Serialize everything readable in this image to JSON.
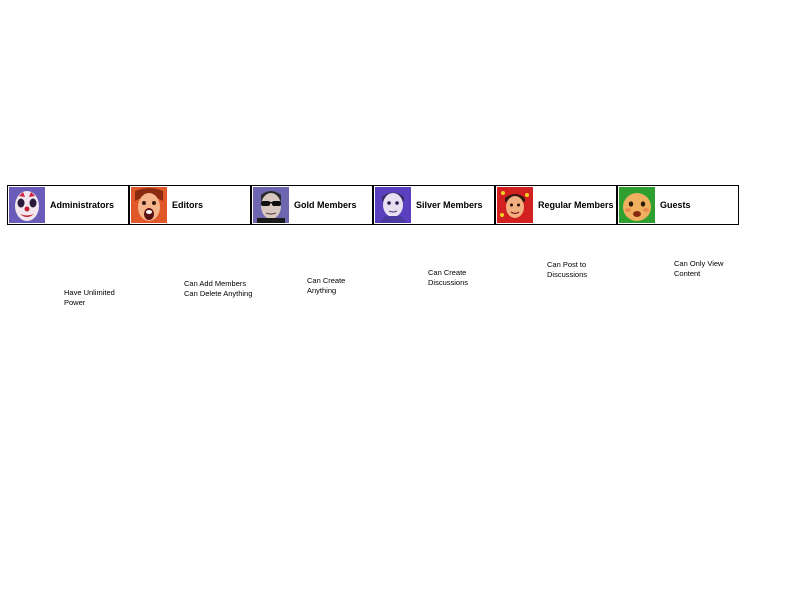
{
  "roles": [
    {
      "label": "Administrators",
      "avatar_icon": "clown-face-icon",
      "avatar_bg": "#6b5bb8",
      "permissions": [
        "Have Unlimited",
        "Power"
      ]
    },
    {
      "label": "Editors",
      "avatar_icon": "screaming-face-icon",
      "avatar_bg": "#e0582a",
      "permissions": [
        "Can Add Members",
        "Can Delete Anything"
      ]
    },
    {
      "label": "Gold Members",
      "avatar_icon": "sunglasses-face-icon",
      "avatar_bg": "#6e66b0",
      "permissions": [
        "Can Create",
        "Anything"
      ]
    },
    {
      "label": "Silver Members",
      "avatar_icon": "boy-face-icon",
      "avatar_bg": "#5a3fbf",
      "permissions": [
        "Can Create",
        "Discussions"
      ]
    },
    {
      "label": "Regular Members",
      "avatar_icon": "kid-face-icon",
      "avatar_bg": "#d22020",
      "permissions": [
        "Can Post to",
        "Discussions"
      ]
    },
    {
      "label": "Guests",
      "avatar_icon": "baby-face-icon",
      "avatar_bg": "#2fa02f",
      "permissions": [
        "Can Only View",
        "Content"
      ]
    }
  ]
}
